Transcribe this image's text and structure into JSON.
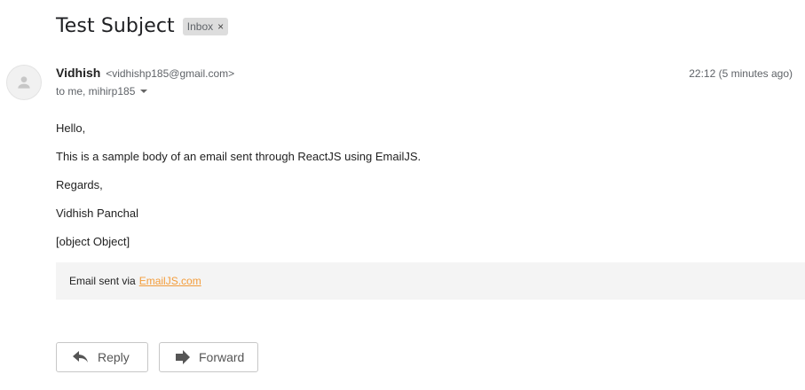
{
  "email": {
    "subject": "Test Subject",
    "label": "Inbox",
    "label_remove": "×",
    "sender_name": "Vidhish",
    "sender_email": "<vidhishp185@gmail.com>",
    "recipients": "to me, mihirp185",
    "timestamp": "22:12 (5 minutes ago)",
    "body": [
      " Hello,",
      "This is a sample body of an email sent through ReactJS using EmailJS.",
      "Regards,",
      "Vidhish Panchal",
      "[object Object]"
    ],
    "footer_text": "Email sent via",
    "footer_link": "EmailJS.com"
  },
  "actions": {
    "reply_label": "Reply",
    "forward_label": "Forward"
  },
  "icons": {
    "avatar": "person-icon",
    "reply": "reply-arrow-icon",
    "forward": "forward-arrow-icon",
    "recipients_toggle": "chevron-down-icon"
  },
  "colors": {
    "link": "#f39c3a",
    "footer_bg": "#f4f4f4",
    "chip_bg": "#dddddd"
  }
}
